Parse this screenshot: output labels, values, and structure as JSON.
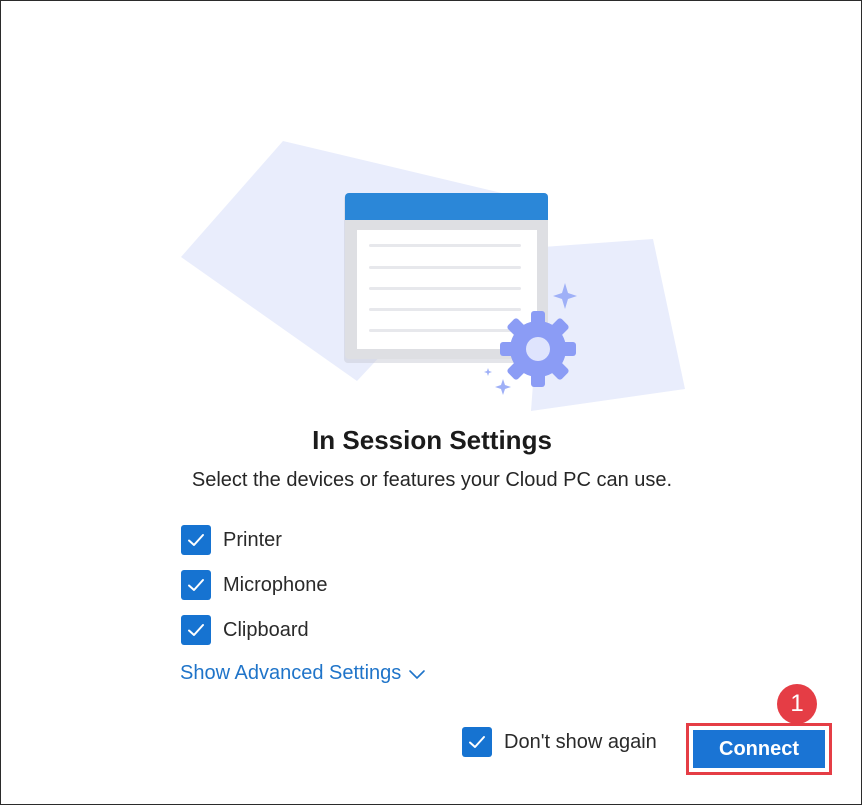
{
  "dialog": {
    "title": "In Session Settings",
    "subtitle": "Select the devices or features your Cloud PC can use."
  },
  "options": [
    {
      "label": "Printer",
      "checked": true
    },
    {
      "label": "Microphone",
      "checked": true
    },
    {
      "label": "Clipboard",
      "checked": true
    }
  ],
  "advanced_link": {
    "label": "Show Advanced Settings",
    "icon": "chevron-down-icon"
  },
  "dont_show_again": {
    "label": "Don't show again",
    "checked": true
  },
  "connect_button": {
    "label": "Connect"
  },
  "annotation": {
    "step_number": "1"
  },
  "colors": {
    "accent": "#1a74d4",
    "link": "#1f74c9",
    "annotation": "#e53d45",
    "illustration_bg": "#e8ecfb",
    "gear": "#8b9cf5"
  }
}
